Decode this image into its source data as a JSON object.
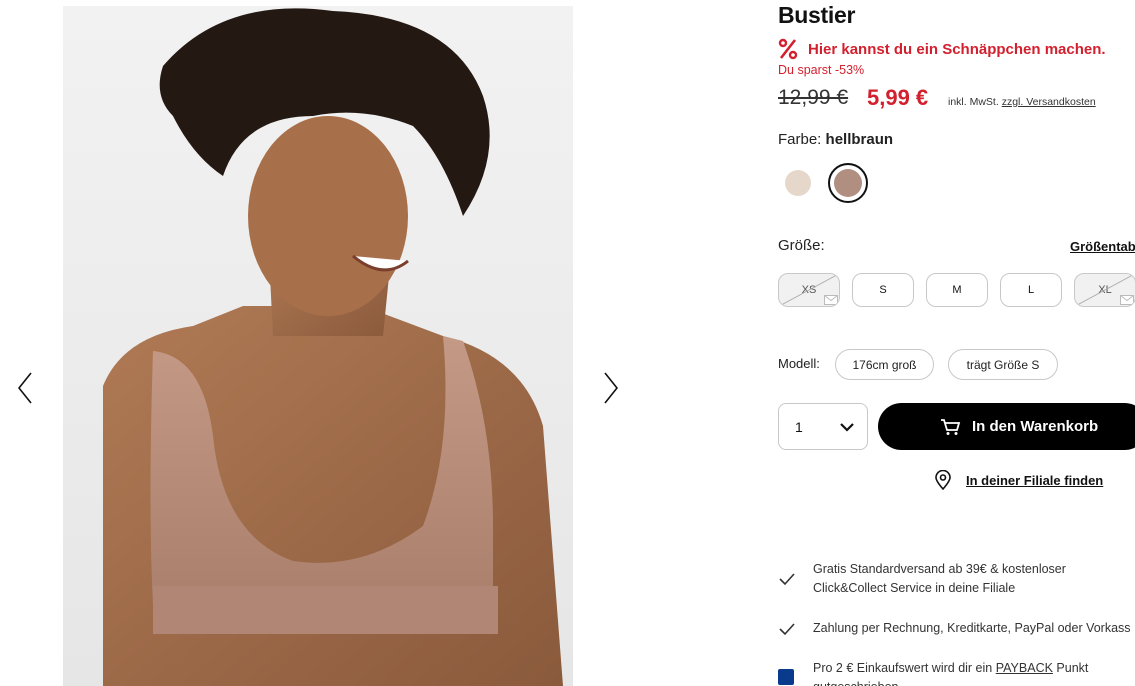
{
  "product": {
    "title": "Bustier",
    "deal_text": "Hier kannst du ein Schnäppchen machen.",
    "savings": "Du sparst -53%",
    "old_price": "12,99 €",
    "new_price": "5,99 €",
    "tax_prefix": "inkl. MwSt.",
    "shipping_link": "zzgl. Versandkosten",
    "accent_color": "#d3202e"
  },
  "color": {
    "label": "Farbe:",
    "selected": "hellbraun",
    "swatches": [
      {
        "name": "light-beige",
        "hex": "#e5d8cb"
      },
      {
        "name": "hellbraun",
        "hex": "#b08e80",
        "selected": true
      }
    ]
  },
  "size": {
    "label": "Größe:",
    "table_link": "Größentab",
    "options": [
      {
        "label": "XS",
        "available": false
      },
      {
        "label": "S",
        "available": true
      },
      {
        "label": "M",
        "available": true
      },
      {
        "label": "L",
        "available": true
      },
      {
        "label": "XL",
        "available": false
      }
    ]
  },
  "model": {
    "label": "Modell:",
    "height": "176cm groß",
    "size_worn": "trägt Größe S"
  },
  "cart": {
    "quantity": "1",
    "add_label": "In den Warenkorb",
    "store_link": "In deiner Filiale finden"
  },
  "usps": {
    "shipping_line1": "Gratis Standardversand ab 39€ & kostenloser",
    "shipping_line2": "Click&Collect Service in deine Filiale",
    "payment": "Zahlung per Rechnung, Kreditkarte, PayPal oder Vorkass",
    "payback_prefix": "Pro 2 € Einkaufswert wird dir ein",
    "payback_brand": "PAYBACK",
    "payback_suffix": "Punkt",
    "payback_line2": "gutgeschrieben"
  },
  "icons": [
    "chevron-left-icon",
    "chevron-right-icon",
    "heart-icon",
    "percent-icon",
    "chevron-down-icon",
    "cart-icon",
    "location-pin-icon",
    "checkmark-icon",
    "payback-icon"
  ]
}
